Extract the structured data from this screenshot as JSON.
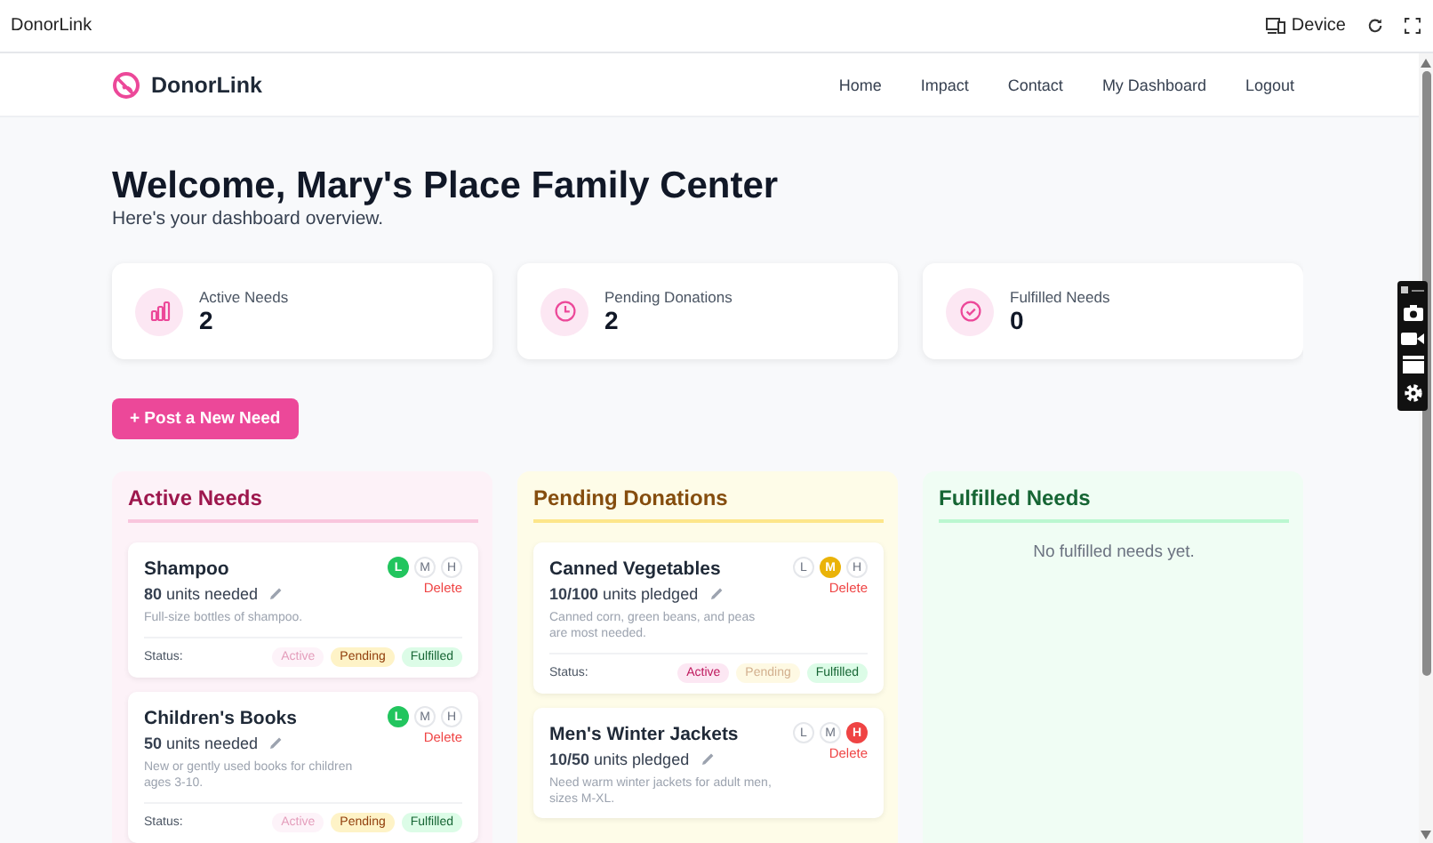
{
  "window": {
    "title": "DonorLink",
    "device_label": "Device"
  },
  "nav": {
    "brand": "DonorLink",
    "links": [
      {
        "label": "Home"
      },
      {
        "label": "Impact"
      },
      {
        "label": "Contact"
      },
      {
        "label": "My Dashboard"
      },
      {
        "label": "Logout"
      }
    ]
  },
  "welcome": {
    "title": "Welcome, Mary's Place Family Center",
    "subtitle": "Here's your dashboard overview."
  },
  "stats": [
    {
      "kind": "chart",
      "label": "Active Needs",
      "value": "2"
    },
    {
      "kind": "clock",
      "label": "Pending Donations",
      "value": "2"
    },
    {
      "kind": "check",
      "label": "Fulfilled Needs",
      "value": "0"
    }
  ],
  "post_button": "+ Post a New Need",
  "columns": [
    {
      "kind": "active",
      "title": "Active Needs",
      "cards": [
        {
          "title": "Shampoo",
          "amount_bold": "80",
          "amount_rest": "units needed",
          "description": "Full-size bottles of shampoo.",
          "delete": "Delete",
          "status_label": "Status:",
          "priorities": [
            {
              "label": "L",
              "selected": true
            },
            {
              "label": "M",
              "selected": false
            },
            {
              "label": "H",
              "selected": false
            }
          ],
          "statuses": [
            {
              "kind": "active",
              "label": "Active",
              "selected": true
            },
            {
              "kind": "pending",
              "label": "Pending",
              "selected": false
            },
            {
              "kind": "fulfilled",
              "label": "Fulfilled",
              "selected": false
            }
          ]
        },
        {
          "title": "Children's Books",
          "amount_bold": "50",
          "amount_rest": "units needed",
          "description": "New or gently used books for children ages 3-10.",
          "delete": "Delete",
          "status_label": "Status:",
          "priorities": [
            {
              "label": "L",
              "selected": true
            },
            {
              "label": "M",
              "selected": false
            },
            {
              "label": "H",
              "selected": false
            }
          ],
          "statuses": [
            {
              "kind": "active",
              "label": "Active",
              "selected": true
            },
            {
              "kind": "pending",
              "label": "Pending",
              "selected": false
            },
            {
              "kind": "fulfilled",
              "label": "Fulfilled",
              "selected": false
            }
          ]
        }
      ]
    },
    {
      "kind": "pending",
      "title": "Pending Donations",
      "cards": [
        {
          "title": "Canned Vegetables",
          "amount_bold": "10/100",
          "amount_rest": "units pledged",
          "description": "Canned corn, green beans, and peas are most needed.",
          "delete": "Delete",
          "status_label": "Status:",
          "priorities": [
            {
              "label": "L",
              "selected": false
            },
            {
              "label": "M",
              "selected": true
            },
            {
              "label": "H",
              "selected": false
            }
          ],
          "statuses": [
            {
              "kind": "active",
              "label": "Active",
              "selected": false
            },
            {
              "kind": "pending",
              "label": "Pending",
              "selected": true
            },
            {
              "kind": "fulfilled",
              "label": "Fulfilled",
              "selected": false
            }
          ]
        },
        {
          "title": "Men's Winter Jackets",
          "amount_bold": "10/50",
          "amount_rest": "units pledged",
          "description": "Need warm winter jackets for adult men, sizes M-XL.",
          "delete": "Delete",
          "priorities": [
            {
              "label": "L",
              "selected": false
            },
            {
              "label": "M",
              "selected": false
            },
            {
              "label": "H",
              "selected": true
            }
          ]
        }
      ]
    },
    {
      "kind": "fulfilled",
      "title": "Fulfilled Needs",
      "empty_text": "No fulfilled needs yet."
    }
  ]
}
